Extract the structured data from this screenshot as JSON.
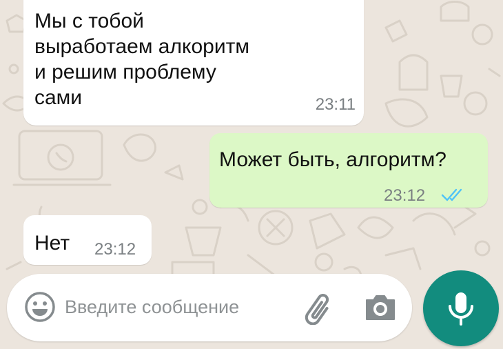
{
  "messages": [
    {
      "direction": "incoming",
      "text": "Мы с тобой\nвыработаем алкоритм\nи решим проблему\nсами",
      "time": "23:11"
    },
    {
      "direction": "outgoing",
      "text": "Может быть, алгоритм?",
      "time": "23:12",
      "status": "read"
    },
    {
      "direction": "incoming",
      "text": "Нет",
      "time": "23:12"
    }
  ],
  "composer": {
    "placeholder": "Введите сообщение",
    "value": ""
  },
  "icons": {
    "emoji": "emoji-icon",
    "attach": "paperclip-icon",
    "camera": "camera-icon",
    "mic": "microphone-icon",
    "read_receipt": "double-check-icon"
  },
  "colors": {
    "wallpaper": "#ece5dd",
    "incoming_bubble": "#ffffff",
    "outgoing_bubble": "#dcf8c6",
    "read_ticks": "#4fc3f7",
    "mic_button": "#128c7e"
  }
}
